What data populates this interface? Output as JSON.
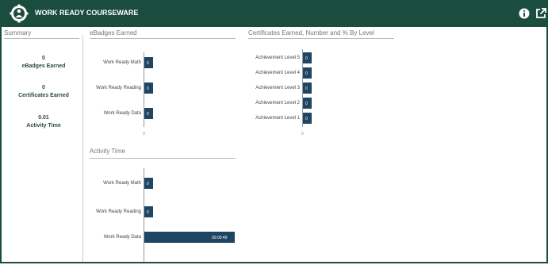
{
  "header": {
    "title": "WORK READY COURSEWARE",
    "logo_icon": "gear-people-logo-icon",
    "info_icon": "info-icon",
    "external_icon": "open-external-icon",
    "bg_color": "#1b4d3e"
  },
  "summary": {
    "title": "Summary",
    "items": [
      {
        "value": "0",
        "label": "eBadges Earned"
      },
      {
        "value": "0",
        "label": "Certificates Earned"
      },
      {
        "value": "0.01",
        "label": "Activity Time"
      }
    ]
  },
  "ebadges": {
    "title": "eBadges Earned",
    "chart_data": {
      "type": "bar",
      "orientation": "horizontal",
      "categories": [
        "Work Ready Math",
        "Work Ready Reading",
        "Work Ready Data"
      ],
      "values": [
        0,
        0,
        0
      ],
      "labels": [
        "0",
        "0",
        "0"
      ],
      "axis_tick": "0"
    }
  },
  "certificates": {
    "title": "Certificates Earned, Number and % By Level",
    "chart_data": {
      "type": "bar",
      "orientation": "horizontal",
      "categories": [
        "Achievement Level 5",
        "Achievement Level 4",
        "Achievement Level 3",
        "Achievement Level 2",
        "Achievement Level 1"
      ],
      "values": [
        0,
        0,
        0,
        0,
        0
      ],
      "labels": [
        "0",
        "0",
        "0",
        "0",
        "0"
      ],
      "axis_tick": "0"
    }
  },
  "activity": {
    "title": "Activity Time",
    "chart_data": {
      "type": "bar",
      "orientation": "horizontal",
      "categories": [
        "Work Ready Math",
        "Work Ready Reading",
        "Work Ready Data"
      ],
      "values": [
        0,
        0,
        49
      ],
      "labels": [
        "0",
        "0",
        "00:00:49"
      ],
      "x_max": 49,
      "bar_color": "#1e4662"
    }
  }
}
